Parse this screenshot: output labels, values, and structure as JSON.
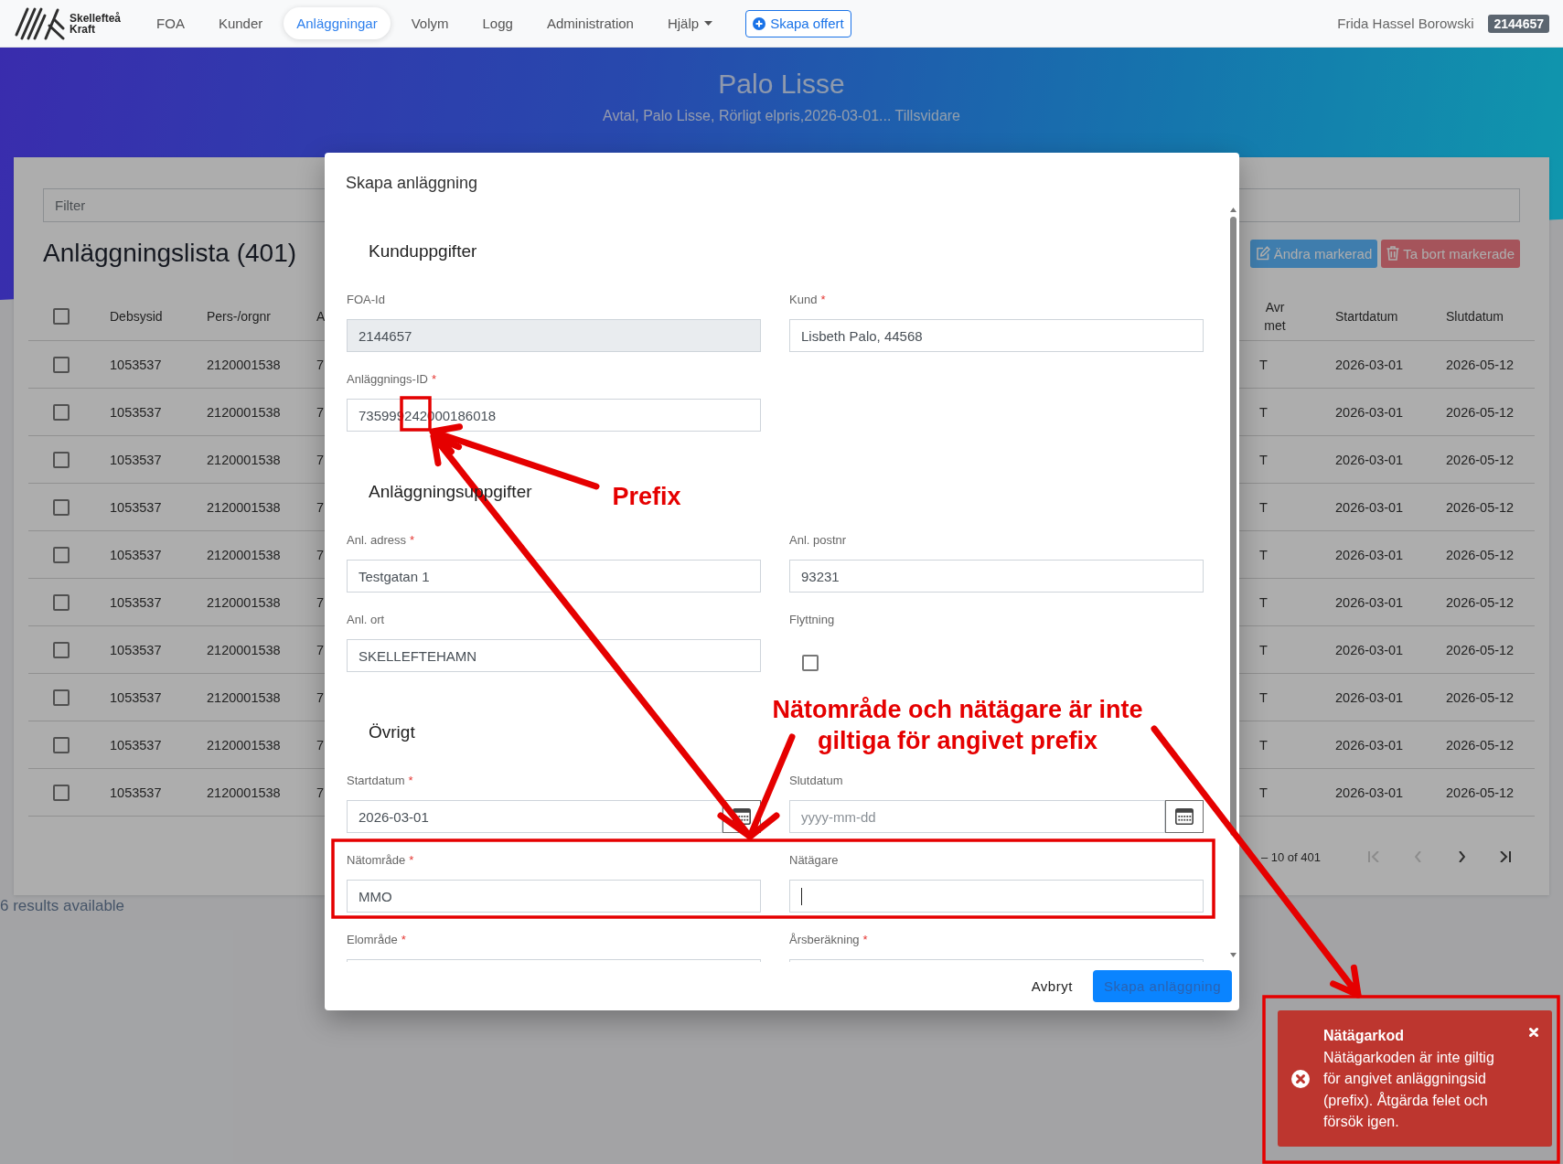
{
  "nav": {
    "brand": "Skellefteå Kraft",
    "items": [
      {
        "label": "FOA",
        "selected": false,
        "dropdown": false
      },
      {
        "label": "Kunder",
        "selected": false,
        "dropdown": false
      },
      {
        "label": "Anläggningar",
        "selected": true,
        "dropdown": false
      },
      {
        "label": "Volym",
        "selected": false,
        "dropdown": false
      },
      {
        "label": "Logg",
        "selected": false,
        "dropdown": false
      },
      {
        "label": "Administration",
        "selected": false,
        "dropdown": false
      },
      {
        "label": "Hjälp",
        "selected": false,
        "dropdown": true
      }
    ],
    "cta": "Skapa offert",
    "user": "Frida Hassel Borowski",
    "badge": "2144657"
  },
  "hero": {
    "title": "Palo Lisse",
    "subtitle": "Avtal, Palo Lisse, Rörligt elpris,2026-03-01... Tillsvidare"
  },
  "list": {
    "filter": {
      "placeholder": "Filter"
    },
    "title": "Anläggningslista (401)",
    "actions": [
      {
        "kind": "edit",
        "label": "Ändra markerad"
      },
      {
        "kind": "delete",
        "label": "Ta bort markerade"
      }
    ],
    "table": {
      "all_checked": false,
      "columns": [
        "Debsysid",
        "Pers-/orgnr",
        "A",
        "Avr met",
        "Startdatum",
        "Slutdatum"
      ],
      "rows": [
        {
          "checked": false,
          "cells": [
            "1053537",
            "2120001538",
            "7",
            "T",
            "2026-03-01",
            "2026-05-12"
          ]
        },
        {
          "checked": false,
          "cells": [
            "1053537",
            "2120001538",
            "7",
            "T",
            "2026-03-01",
            "2026-05-12"
          ]
        },
        {
          "checked": false,
          "cells": [
            "1053537",
            "2120001538",
            "7",
            "T",
            "2026-03-01",
            "2026-05-12"
          ]
        },
        {
          "checked": false,
          "cells": [
            "1053537",
            "2120001538",
            "7",
            "T",
            "2026-03-01",
            "2026-05-12"
          ]
        },
        {
          "checked": false,
          "cells": [
            "1053537",
            "2120001538",
            "7",
            "T",
            "2026-03-01",
            "2026-05-12"
          ]
        },
        {
          "checked": false,
          "cells": [
            "1053537",
            "2120001538",
            "7",
            "T",
            "2026-03-01",
            "2026-05-12"
          ]
        },
        {
          "checked": false,
          "cells": [
            "1053537",
            "2120001538",
            "7",
            "T",
            "2026-03-01",
            "2026-05-12"
          ]
        },
        {
          "checked": false,
          "cells": [
            "1053537",
            "2120001538",
            "7",
            "T",
            "2026-03-01",
            "2026-05-12"
          ]
        },
        {
          "checked": false,
          "cells": [
            "1053537",
            "2120001538",
            "7",
            "T",
            "2026-03-01",
            "2026-05-12"
          ]
        },
        {
          "checked": false,
          "cells": [
            "1053537",
            "2120001538",
            "7",
            "T",
            "2026-03-01",
            "2026-05-12"
          ]
        }
      ]
    },
    "pagination": {
      "range": "– 10 of 401",
      "buttons": [
        {
          "kind": "first",
          "disabled": true
        },
        {
          "kind": "previous",
          "disabled": true
        },
        {
          "kind": "next",
          "disabled": false
        },
        {
          "kind": "last",
          "disabled": false
        }
      ]
    }
  },
  "live_region": "6 results available",
  "dialog": {
    "title": "Skapa anläggning",
    "sections": [
      {
        "heading": "Kunduppgifter",
        "fields": [
          {
            "kind": "text",
            "label": "FOA-Id",
            "value": "2144657",
            "disabled": true,
            "focused": false
          },
          {
            "kind": "text",
            "label": "Kund",
            "mark": "*",
            "value": "Lisbeth Palo, 44568",
            "disabled": false,
            "focused": false
          },
          {
            "kind": "text",
            "label": "Anläggnings-ID",
            "mark": "*",
            "value": "735999242000186018",
            "disabled": false,
            "focused": false
          }
        ]
      },
      {
        "heading": "Anläggningsuppgifter",
        "fields": [
          {
            "kind": "text",
            "label": "Anl. adress",
            "mark": "*",
            "value": "Testgatan 1",
            "disabled": false,
            "focused": false
          },
          {
            "kind": "text",
            "label": "Anl. postnr",
            "value": "93231",
            "disabled": false,
            "focused": false
          },
          {
            "kind": "text",
            "label": "Anl. ort",
            "value": "SKELLEFTEHAMN",
            "disabled": false,
            "focused": false
          },
          {
            "kind": "checkbox",
            "label": "Flyttning",
            "checked": false
          }
        ]
      },
      {
        "heading": "Övrigt",
        "fields": [
          {
            "kind": "date",
            "label": "Startdatum",
            "mark": "*",
            "value": "2026-03-01",
            "disabled": false,
            "focused": false
          },
          {
            "kind": "date",
            "label": "Slutdatum",
            "placeholder": "yyyy-mm-dd",
            "disabled": false,
            "focused": false
          },
          {
            "kind": "text",
            "label": "Nätområde",
            "mark": "*",
            "value": "MMO",
            "disabled": false,
            "focused": false
          },
          {
            "kind": "text",
            "label": "Nätägare",
            "disabled": false,
            "focused": true
          },
          {
            "kind": "text",
            "label": "Elområde",
            "mark": "*",
            "disabled": false
          },
          {
            "kind": "text",
            "label": "Årsberäkning",
            "mark": "*",
            "disabled": false
          }
        ]
      }
    ],
    "cancel": "Avbryt",
    "submit": {
      "label": "Skapa anläggning",
      "disabled": true
    }
  },
  "toast": {
    "kind": "error",
    "title": "Nätägarkod",
    "message": "Nätägarkoden är inte giltig för angivet anläggningsid (prefix). Åtgärda felet och försök igen."
  },
  "annotations": [
    {
      "kind": "label",
      "text": "Prefix"
    },
    {
      "kind": "label",
      "text": "Nätområde och nätägare är inte giltiga för angivet prefix"
    }
  ]
}
